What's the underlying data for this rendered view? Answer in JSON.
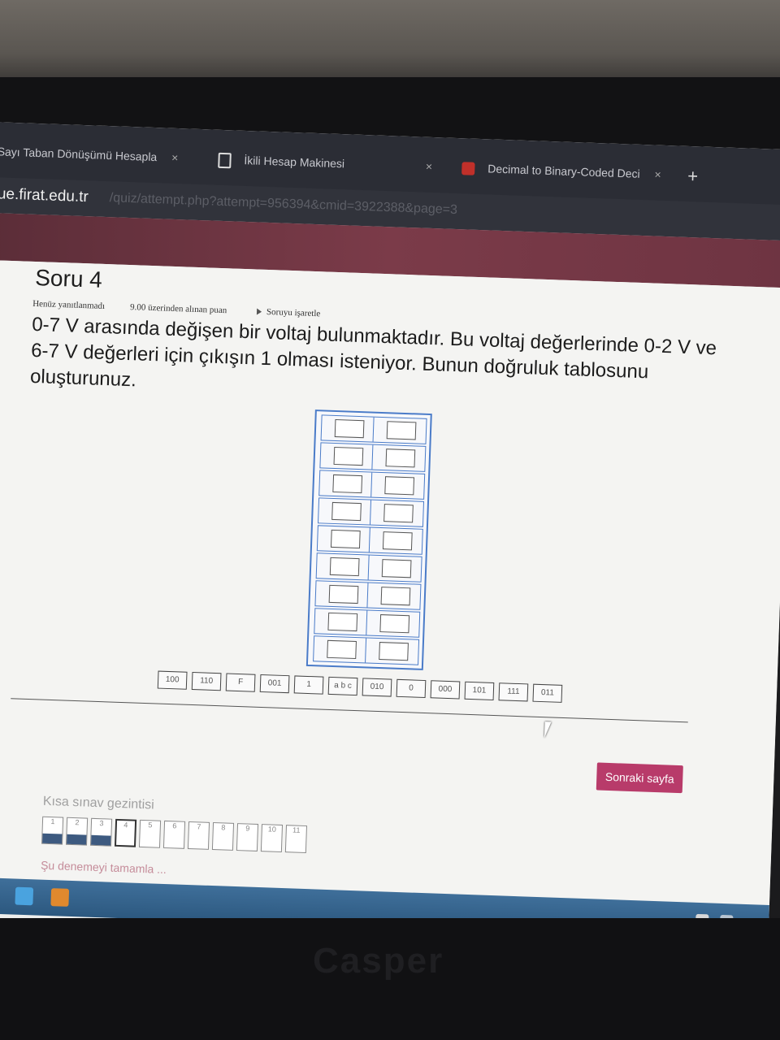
{
  "browser": {
    "tabs": [
      {
        "label": "Sayı Taban Dönüşümü Hesapla",
        "close": "×"
      },
      {
        "label": "İkili Hesap Makinesi",
        "close": "×"
      },
      {
        "label": "Decimal to Binary-Coded Deci",
        "close": "×"
      }
    ],
    "new_tab": "+",
    "url_host": "ue.firat.edu.tr",
    "url_path": "/quiz/attempt.php?attempt=956394&cmid=3922388&page=3"
  },
  "question": {
    "title": "Soru 4",
    "status": "Henüz yanıtlanmadı",
    "points": "9.00 üzerinden alınan puan",
    "flag_label": "Soruyu işaretle",
    "text": "0-7 V arasında değişen bir voltaj bulunmaktadır. Bu voltaj değerlerinde 0-2 V ve 6-7 V değerleri için çıkışın 1 olması isteniyor. Bunun doğruluk tablosunu oluşturunuz."
  },
  "drag_items": [
    "100",
    "110",
    "F",
    "001",
    "1",
    "a b c",
    "010",
    "0",
    "000",
    "101",
    "111",
    "011"
  ],
  "buttons": {
    "next": "Sonraki sayfa"
  },
  "quiz_nav": {
    "title": "Kısa sınav gezintisi",
    "items": [
      "1",
      "2",
      "3",
      "4",
      "5",
      "6",
      "7",
      "8",
      "9",
      "10",
      "11"
    ],
    "finish": "Şu denemeyi tamamla ..."
  },
  "device": {
    "brand": "Casper"
  },
  "colors": {
    "accent": "#b83b6a",
    "table_border": "#4a7bc8",
    "answered": "#3d5a80"
  }
}
